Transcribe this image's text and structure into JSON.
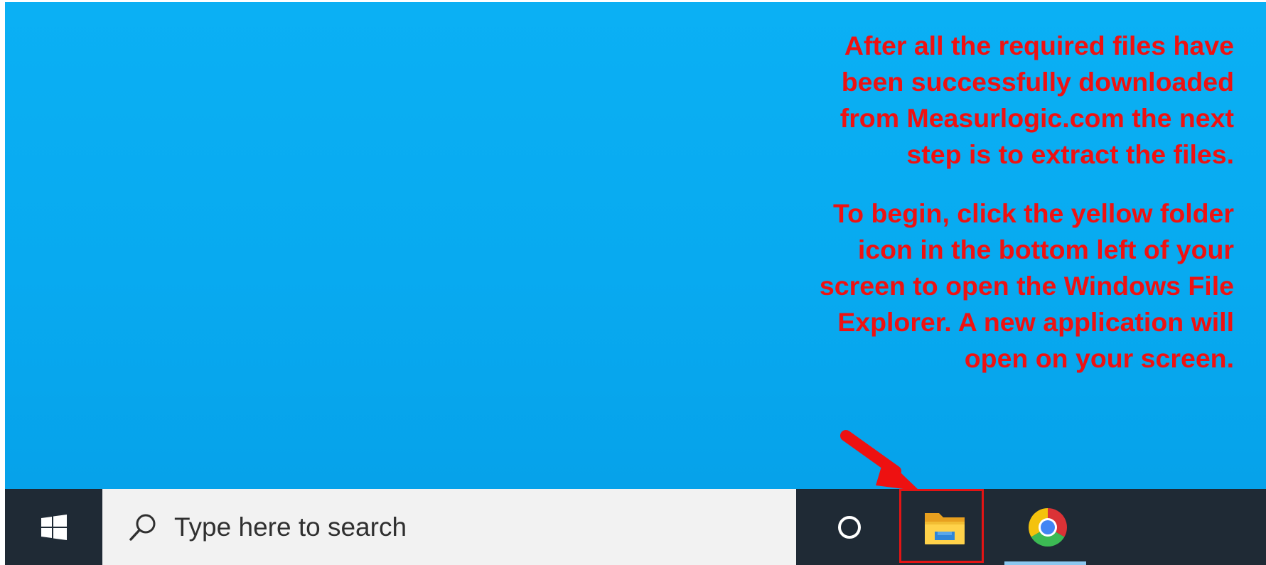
{
  "instructions": {
    "paragraph_1": "After all the required files have been successfully downloaded from Measurlogic.com the next step is to extract the files.",
    "paragraph_2": "To begin, click the yellow folder icon in the bottom left of your screen to open the Windows File Explorer. A new application will open on your screen.",
    "text_color": "#ef1111"
  },
  "desktop": {
    "background_color": "#08aaf0"
  },
  "taskbar": {
    "background_color": "#1f2a35",
    "start_icon": "windows-logo-icon",
    "search": {
      "placeholder": "Type here to search",
      "icon": "search-icon"
    },
    "pinned_apps": [
      {
        "icon": "cortana-icon"
      },
      {
        "icon": "file-explorer-folder-icon",
        "highlighted": true
      },
      {
        "icon": "chrome-icon",
        "active": true
      }
    ],
    "highlight_color": "#e41414"
  }
}
